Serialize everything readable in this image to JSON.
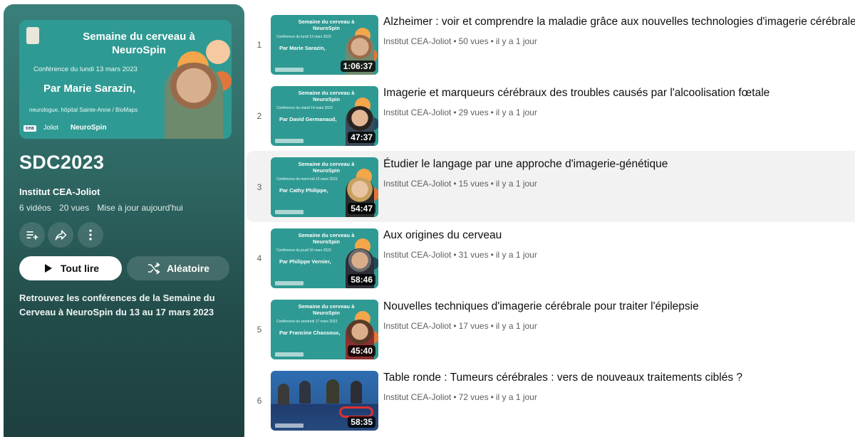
{
  "playlist": {
    "thumbnail": {
      "title": "Semaine du cerveau à NeuroSpin",
      "conference": "Conférence du lundi 13 mars 2023",
      "speaker": "Par Marie Sarazin,",
      "role": "neurologue, hôpital Sainte-Anne / BioMaps",
      "logo_cea": "cea",
      "logo_joliot": "Joliot",
      "logo_neurospin": "NeuroSpin"
    },
    "title": "SDC2023",
    "channel": "Institut CEA-Joliot",
    "videos_count": "6 vidéos",
    "views": "20 vues",
    "updated": "Mise à jour aujourd'hui",
    "play_all_label": "Tout lire",
    "shuffle_label": "Aléatoire",
    "description": "Retrouvez les conférences de la Semaine du Cerveau à NeuroSpin du 13 au 17 mars 2023",
    "icons": [
      "add-to-queue-icon",
      "share-icon",
      "more-vert-icon",
      "play-icon",
      "shuffle-icon"
    ]
  },
  "videos": [
    {
      "index": "1",
      "title": "Alzheimer : voir et comprendre la maladie grâce aux nouvelles technologies d'imagerie cérébrale",
      "channel": "Institut CEA-Joliot",
      "views": "50 vues",
      "age": "il y a 1 jour",
      "duration": "1:06:37",
      "thumb": {
        "title": "Semaine du cerveau à NeuroSpin",
        "conference": "Conférence du lundi 13 mars 2023",
        "speaker": "Par Marie Sarazin,"
      }
    },
    {
      "index": "2",
      "title": "Imagerie et marqueurs cérébraux des troubles causés par l'alcoolisation fœtale",
      "channel": "Institut CEA-Joliot",
      "views": "29 vues",
      "age": "il y a 1 jour",
      "duration": "47:37",
      "thumb": {
        "title": "Semaine du cerveau à NeuroSpin",
        "conference": "Conférence du mardi 14 mars 2023",
        "speaker": "Par David Germanaud,"
      }
    },
    {
      "index": "3",
      "title": "Étudier le langage par une approche d'imagerie-génétique",
      "channel": "Institut CEA-Joliot",
      "views": "15 vues",
      "age": "il y a 1 jour",
      "duration": "54:47",
      "thumb": {
        "title": "Semaine du cerveau à NeuroSpin",
        "conference": "Conférence du mercredi 15 mars 2023",
        "speaker": "Par Cathy Philippe,"
      }
    },
    {
      "index": "4",
      "title": "Aux origines du cerveau",
      "channel": "Institut CEA-Joliot",
      "views": "31 vues",
      "age": "il y a 1 jour",
      "duration": "58:46",
      "thumb": {
        "title": "Semaine du cerveau à NeuroSpin",
        "conference": "Conférence du jeudi 16 mars 2023",
        "speaker": "Par Philippe Vernier,"
      }
    },
    {
      "index": "5",
      "title": "Nouvelles techniques d'imagerie cérébrale pour traiter l'épilepsie",
      "channel": "Institut CEA-Joliot",
      "views": "17 vues",
      "age": "il y a 1 jour",
      "duration": "45:40",
      "thumb": {
        "title": "Semaine du cerveau à NeuroSpin",
        "conference": "Conférence du vendredi 17 mars 2023",
        "speaker": "Par Francine Chassoux,"
      }
    },
    {
      "index": "6",
      "title": "Table ronde : Tumeurs cérébrales : vers de nouveaux traitements ciblés ?",
      "channel": "Institut CEA-Joliot",
      "views": "72 vues",
      "age": "il y a 1 jour",
      "duration": "58:35",
      "thumb": {}
    }
  ],
  "colors": {
    "panel_top": "#3a7f7a",
    "panel_bottom": "#1d3f3d",
    "thumb_teal": "#2f9a93",
    "hover_row": "#f2f2f2",
    "meta_gray": "#606060"
  }
}
